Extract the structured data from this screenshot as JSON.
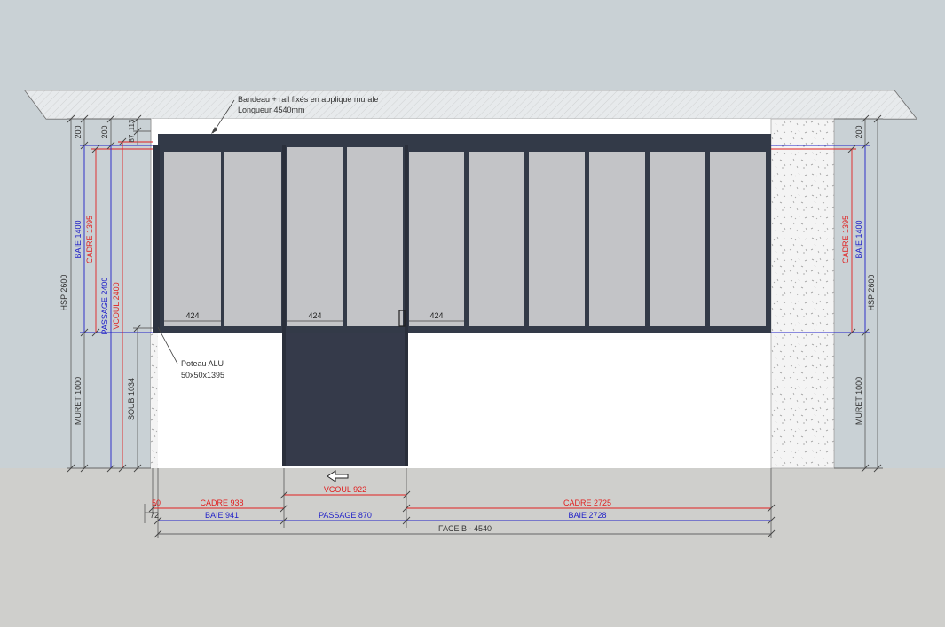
{
  "annotations": {
    "bandeau_line1": "Bandeau + rail fixés en applique murale",
    "bandeau_line2": "Longueur 4540mm",
    "poteau_line1": "Poteau ALU",
    "poteau_line2": "50x50x1395"
  },
  "left_dims": {
    "top_200_a": "200",
    "top_200_b": "200",
    "top_87": "87",
    "top_113": "113",
    "hsp": "HSP 2600",
    "baie": "BAIE 1400",
    "cadre": "CADRE 1395",
    "passage": "PASSAGE 2400",
    "vcoul": "VCOUL 2400",
    "muret": "MURET 1000",
    "soub": "SOUB 1034"
  },
  "right_dims": {
    "top_200": "200",
    "cadre": "CADRE 1395",
    "baie": "BAIE 1400",
    "hsp": "HSP 2600",
    "muret": "MURET 1000"
  },
  "inner_dims": {
    "left_pane": "424",
    "door_pane": "424",
    "right_pane": "424"
  },
  "bottom_dims": {
    "vcoul": "VCOUL 922",
    "cadre_left": "CADRE 938",
    "cadre_right": "CADRE 2725",
    "small_50": "50",
    "small_72": "72",
    "baie_left": "BAIE 941",
    "passage": "PASSAGE 870",
    "baie_right": "BAIE 2728",
    "face": "FACE B - 4540"
  },
  "colors": {
    "background": "#c9d1d5",
    "floor": "#cfcfcc",
    "frame": "#333a48",
    "glass": "#c3c4c7",
    "dim_red": "#e02020",
    "dim_blue": "#2020c8",
    "dim_gray": "#555555"
  }
}
